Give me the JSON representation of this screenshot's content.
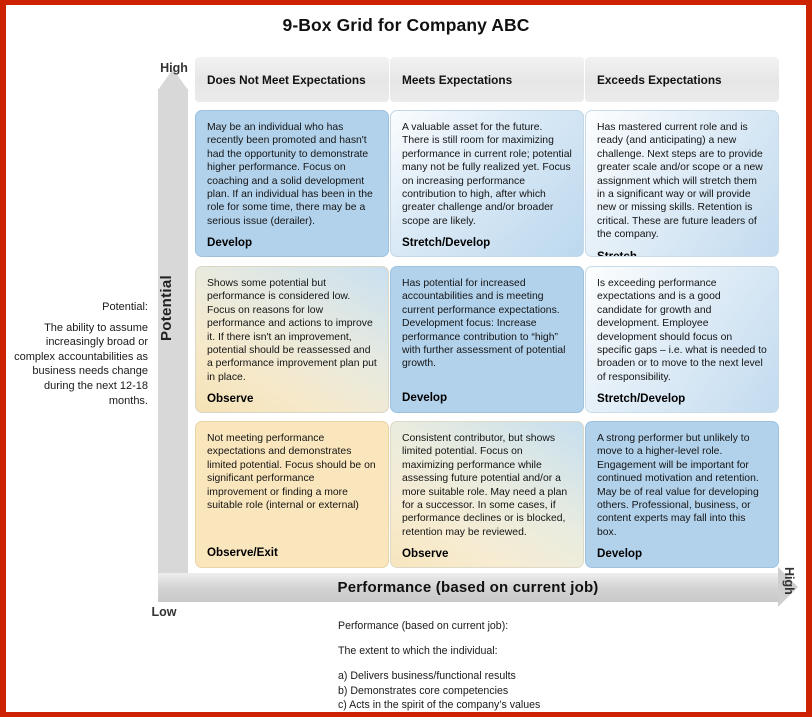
{
  "title": "9-Box Grid for Company ABC",
  "axes": {
    "y": {
      "label": "Potential",
      "high": "High",
      "low": "Low",
      "description_header": "Potential:",
      "description_body": "The ability to assume increasingly broad or complex accountabilities as business needs change during the next 12-18 months."
    },
    "x": {
      "label": "Performance (based on current job)",
      "high": "High"
    }
  },
  "columns": [
    {
      "label": "Does Not Meet Expectations"
    },
    {
      "label": "Meets Expectations"
    },
    {
      "label": "Exceeds Expectations"
    }
  ],
  "cells": [
    {
      "row": "high-potential",
      "col": "does-not-meet",
      "text": "May be an individual who has recently been promoted and hasn't had the opportunity to demonstrate higher performance. Focus on coaching and a solid development plan. If an individual has been in the role for some time, there may be a serious issue (derailer).",
      "action": "Develop"
    },
    {
      "row": "high-potential",
      "col": "meets",
      "text": "A valuable asset for the future. There is still room for maximizing performance in current role; potential many not be fully realized yet. Focus on increasing performance contribution to high, after which greater challenge and/or broader scope are likely.",
      "action": "Stretch/Develop"
    },
    {
      "row": "high-potential",
      "col": "exceeds",
      "text": "Has mastered current role and is ready (and anticipating) a new challenge. Next steps are to provide greater scale and/or scope or a new assignment which will stretch them in a significant way or will provide new or missing skills. Retention is critical. These are future leaders of the company.",
      "action": "Stretch"
    },
    {
      "row": "medium-potential",
      "col": "does-not-meet",
      "text": "Shows some potential but performance is considered low. Focus on reasons for low performance and actions to improve it. If there isn't an improvement, potential should be reassessed and a performance improvement plan put in place.",
      "action": "Observe"
    },
    {
      "row": "medium-potential",
      "col": "meets",
      "text": "Has potential for increased accountabilities and is meeting current performance expectations. Development focus: Increase performance contribution to “high” with further assessment of potential growth.",
      "action": "Develop"
    },
    {
      "row": "medium-potential",
      "col": "exceeds",
      "text": "Is exceeding performance expectations and is a good candidate for growth and development. Employee development should focus on specific gaps – i.e. what is needed to broaden or to move to the next level of responsibility.",
      "action": "Stretch/Develop"
    },
    {
      "row": "low-potential",
      "col": "does-not-meet",
      "text": "Not meeting performance expectations and demonstrates limited potential. Focus should be on significant performance improvement or finding a more suitable role (internal or external)",
      "action": "Observe/Exit"
    },
    {
      "row": "low-potential",
      "col": "meets",
      "text": "Consistent contributor, but shows limited potential. Focus on maximizing performance while assessing future potential and/or a more suitable role. May need a plan for a successor. In some cases, if performance declines or is blocked, retention may be reviewed.",
      "action": "Observe"
    },
    {
      "row": "low-potential",
      "col": "exceeds",
      "text": "A strong performer but unlikely to move to a higher-level role. Engagement will be important for continued motivation and retention. May be of real value for developing others. Professional, business, or content experts may fall into this box.",
      "action": "Develop"
    }
  ],
  "footnote": {
    "line1": "Performance (based on current job):",
    "line2": "The extent to which the individual:",
    "item_a": "a) Delivers business/functional results",
    "item_b": "b) Demonstrates core competencies",
    "item_c": "c) Acts in the spirit of the company’s values"
  },
  "colors": {
    "frame": "#cc2200",
    "blue": "#b2d2ec",
    "tan": "#fae6bd",
    "header_gray": "#e9e9e9",
    "arrow_gray": "#d8d8d8"
  }
}
